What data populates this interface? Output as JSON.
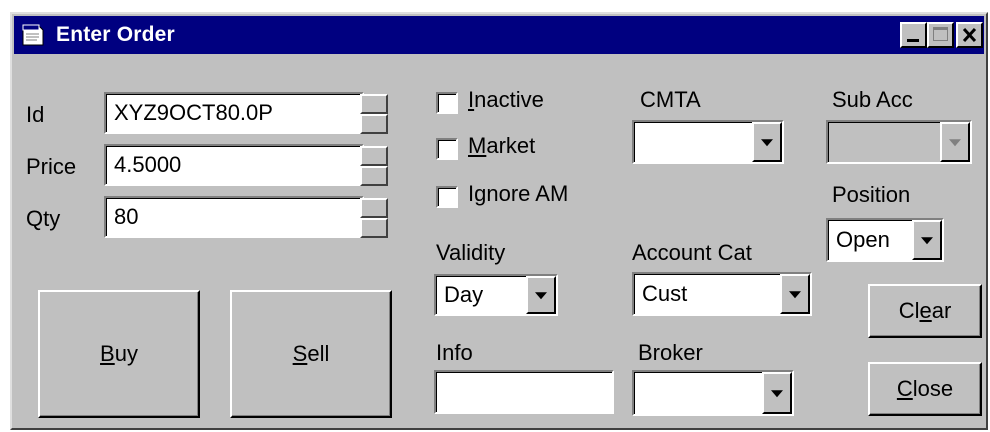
{
  "window": {
    "title": "Enter Order",
    "icon": "notepad-icon"
  },
  "title_buttons": [
    "minimize-icon",
    "maximize-icon",
    "close-icon"
  ],
  "fields": {
    "id": {
      "label_prefix": "",
      "label_accel": "",
      "label_rest": "Id",
      "value": "XYZ9OCT80.0P"
    },
    "price": {
      "label_rest": "Price",
      "value": "4.5000"
    },
    "qty": {
      "label_rest": "Qty",
      "value": "80"
    }
  },
  "checkboxes": [
    {
      "accel": "I",
      "rest": "nactive",
      "checked": false
    },
    {
      "accel": "M",
      "rest": "arket",
      "checked": false
    },
    {
      "accel": "",
      "rest": "Ignore AM",
      "checked": false
    }
  ],
  "validity": {
    "label": "Validity",
    "value": "Day"
  },
  "info": {
    "label": "Info",
    "value": ""
  },
  "cmta": {
    "label": "CMTA",
    "value": ""
  },
  "account_cat": {
    "label": "Account Cat",
    "value": "Cust"
  },
  "broker": {
    "label": "Broker",
    "value": ""
  },
  "sub_acc": {
    "label": "Sub Acc",
    "value": "",
    "disabled": true
  },
  "position": {
    "label": "Position",
    "value": "Open"
  },
  "buttons": {
    "buy": {
      "accel": "B",
      "rest": "uy"
    },
    "sell": {
      "accel": "S",
      "rest": "ell"
    },
    "clear": {
      "pre": "Cl",
      "accel": "e",
      "rest": "ar"
    },
    "close": {
      "accel": "C",
      "rest": "lose"
    }
  }
}
